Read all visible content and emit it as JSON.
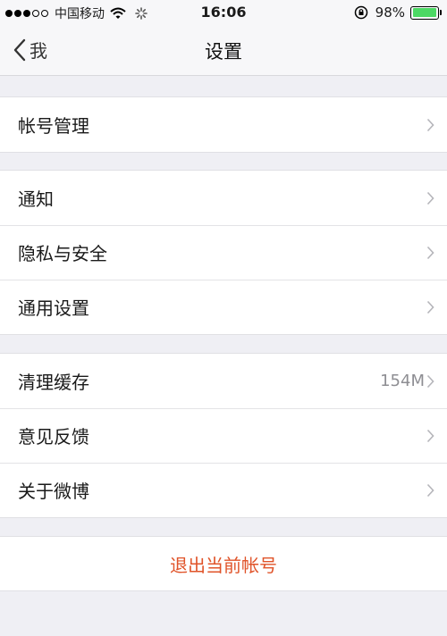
{
  "statusbar": {
    "carrier": "中国移动",
    "time": "16:06",
    "battery": "98%",
    "battery_level": 0.98
  },
  "nav": {
    "back_label": "我",
    "title": "设置"
  },
  "groups": [
    {
      "rows": [
        {
          "label": "帐号管理"
        }
      ]
    },
    {
      "rows": [
        {
          "label": "通知"
        },
        {
          "label": "隐私与安全"
        },
        {
          "label": "通用设置"
        }
      ]
    },
    {
      "rows": [
        {
          "label": "清理缓存",
          "value": "154M"
        },
        {
          "label": "意见反馈"
        },
        {
          "label": "关于微博"
        }
      ]
    }
  ],
  "logout": {
    "label": "退出当前帐号",
    "color": "#e0542a"
  },
  "colors": {
    "background": "#efeff4",
    "battery_fill": "#4cd964"
  },
  "icons": [
    "wifi-icon",
    "activity-spinner-icon",
    "rotation-lock-icon",
    "battery-icon",
    "back-chevron-icon",
    "chevron-right-icon"
  ]
}
